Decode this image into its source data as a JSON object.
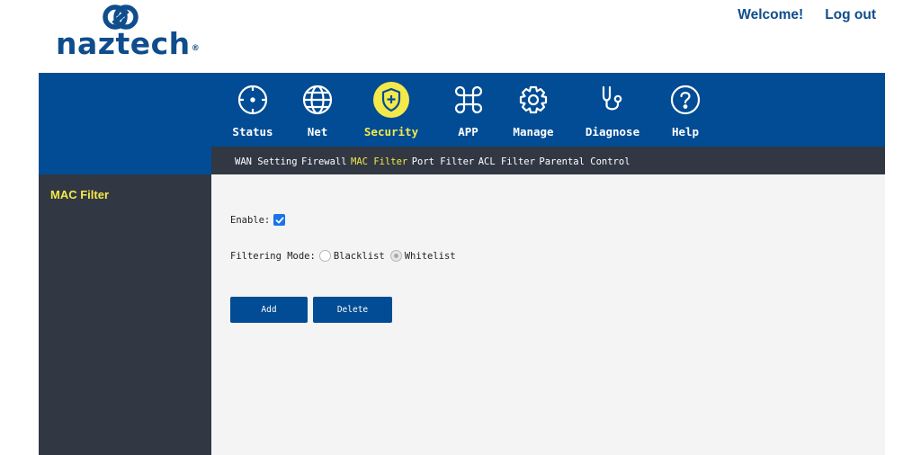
{
  "brand": {
    "name": "naztech",
    "reg": "®",
    "color": "#0f4d8c"
  },
  "header": {
    "welcome": "Welcome!",
    "logout": "Log out"
  },
  "nav": [
    {
      "label": "Status",
      "icon": "crosshair-icon"
    },
    {
      "label": "Net",
      "icon": "globe-icon"
    },
    {
      "label": "Security",
      "icon": "shield-plus-icon",
      "active": true
    },
    {
      "label": "APP",
      "icon": "command-icon"
    },
    {
      "label": "Manage",
      "icon": "gear-icon"
    },
    {
      "label": "Diagnose",
      "icon": "stethoscope-icon"
    },
    {
      "label": "Help",
      "icon": "question-icon"
    }
  ],
  "subnav": [
    "WAN Setting",
    "Firewall",
    "MAC Filter",
    "Port Filter",
    "ACL Filter",
    "Parental Control"
  ],
  "subnav_active": "MAC Filter",
  "sidebar": {
    "item": "MAC Filter"
  },
  "form": {
    "enable_label": "Enable:",
    "enable_checked": true,
    "mode_label": "Filtering Mode:",
    "mode_options": [
      "Blacklist",
      "Whitelist"
    ],
    "mode_selected": "Whitelist"
  },
  "buttons": {
    "add": "Add",
    "delete": "Delete"
  },
  "colors": {
    "primary": "#014c94",
    "dark": "#313843",
    "highlight": "#f5e94a",
    "content_bg": "#f4f4f4"
  }
}
